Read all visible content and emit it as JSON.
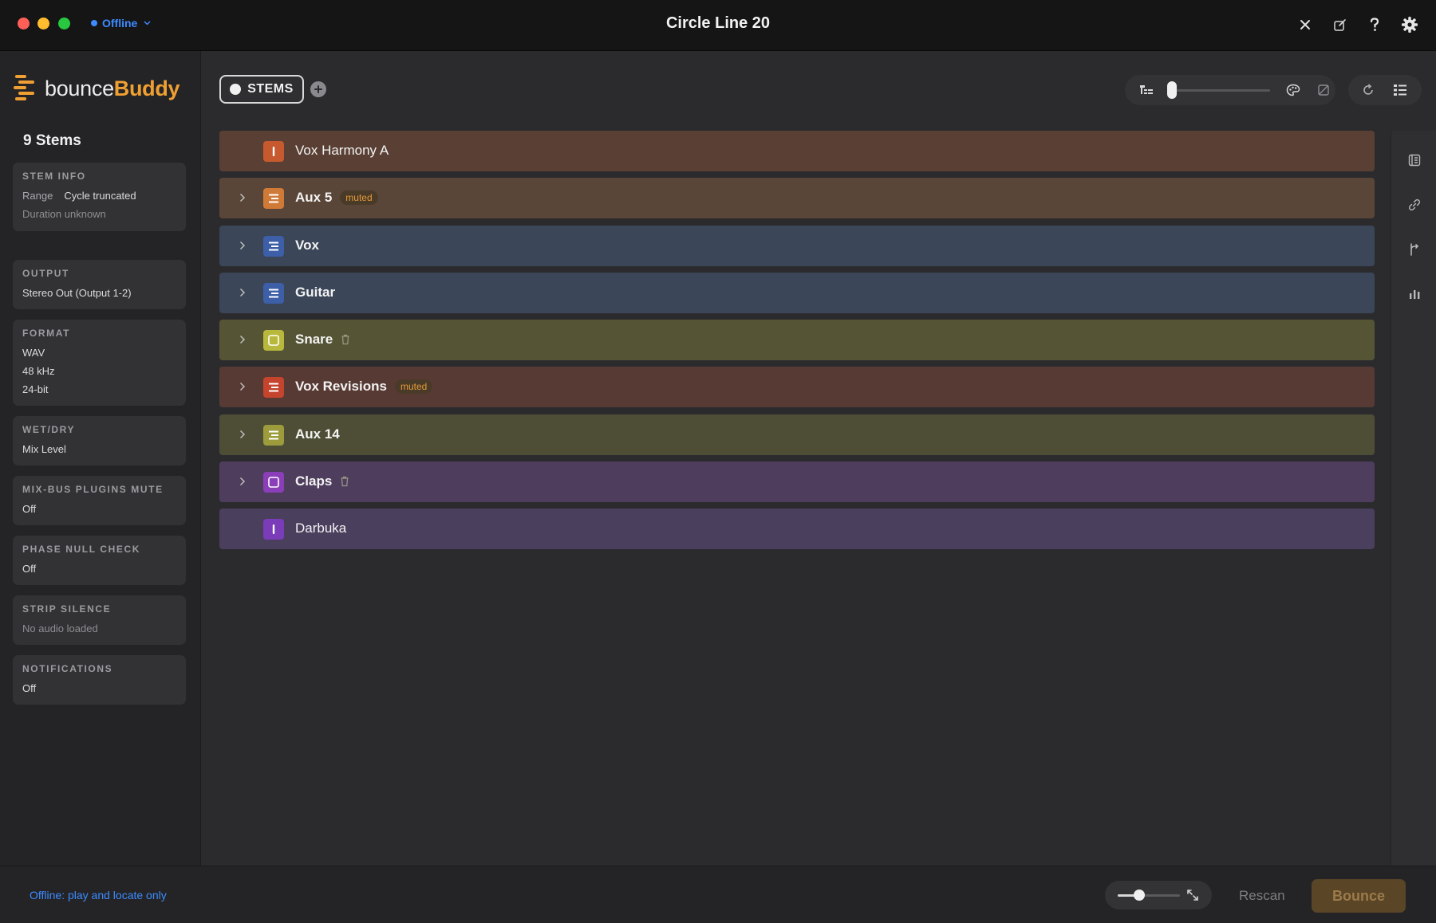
{
  "window": {
    "title": "Circle Line 20"
  },
  "connection": {
    "status": "Offline",
    "color": "#3d8bff"
  },
  "titlebar_icons": [
    "close-icon",
    "compose-icon",
    "help-icon",
    "gear-icon"
  ],
  "brand": {
    "name_prefix": "bounce",
    "name_accent": "Buddy",
    "accent_color": "#f0a033"
  },
  "sidebar": {
    "stems_count": "9 Stems",
    "stem_info": {
      "title": "STEM INFO",
      "range_key": "Range",
      "range_value": "Cycle truncated",
      "duration": "Duration unknown"
    },
    "output": {
      "title": "OUTPUT",
      "value": "Stereo Out (Output 1-2)"
    },
    "format": {
      "title": "FORMAT",
      "file_type": "WAV",
      "sample_rate": "48 kHz",
      "bit_depth": "24-bit"
    },
    "wet_dry": {
      "title": "WET/DRY",
      "value": "Mix Level"
    },
    "mix_bus": {
      "title": "MIX-BUS PLUGINS MUTE",
      "value": "Off"
    },
    "phase_null": {
      "title": "PHASE NULL CHECK",
      "value": "Off"
    },
    "strip_silence": {
      "title": "STRIP SILENCE",
      "value": "No audio loaded"
    },
    "notifications": {
      "title": "NOTIFICATIONS",
      "value": "Off"
    }
  },
  "toolbar": {
    "stems_tab": "STEMS",
    "zoom_level": 0.0
  },
  "stems": [
    {
      "name": "Vox Harmony A",
      "type": "track",
      "expandable": false,
      "bold": false,
      "badge": "",
      "trash": false,
      "row_color": "#5a4034",
      "icon_color": "#c65a2e"
    },
    {
      "name": "Aux 5",
      "type": "folder",
      "expandable": true,
      "bold": true,
      "badge": "muted",
      "trash": false,
      "row_color": "#5a4638",
      "icon_color": "#d07a38"
    },
    {
      "name": "Vox",
      "type": "folder",
      "expandable": true,
      "bold": true,
      "badge": "",
      "trash": false,
      "row_color": "#3b4658",
      "icon_color": "#3d5fa8"
    },
    {
      "name": "Guitar",
      "type": "folder",
      "expandable": true,
      "bold": true,
      "badge": "",
      "trash": false,
      "row_color": "#3b4658",
      "icon_color": "#3d5fa8"
    },
    {
      "name": "Snare",
      "type": "aux",
      "expandable": true,
      "bold": true,
      "badge": "",
      "trash": true,
      "row_color": "#555536",
      "icon_color": "#b8b83c"
    },
    {
      "name": "Vox Revisions",
      "type": "folder",
      "expandable": true,
      "bold": true,
      "badge": "muted",
      "trash": false,
      "row_color": "#583a34",
      "icon_color": "#c4442e"
    },
    {
      "name": "Aux 14",
      "type": "folder",
      "expandable": true,
      "bold": true,
      "badge": "",
      "trash": false,
      "row_color": "#4e4e36",
      "icon_color": "#9c9c3c"
    },
    {
      "name": "Claps",
      "type": "aux",
      "expandable": true,
      "bold": true,
      "badge": "",
      "trash": true,
      "row_color": "#4f3d5e",
      "icon_color": "#8a3fb8"
    },
    {
      "name": "Darbuka",
      "type": "track",
      "expandable": false,
      "bold": false,
      "badge": "",
      "trash": false,
      "row_color": "#4b3f5e",
      "icon_color": "#7a3cb8"
    }
  ],
  "statusbar": {
    "message": "Offline: play and locate only",
    "size_level": 0.35,
    "rescan_label": "Rescan",
    "bounce_label": "Bounce"
  }
}
